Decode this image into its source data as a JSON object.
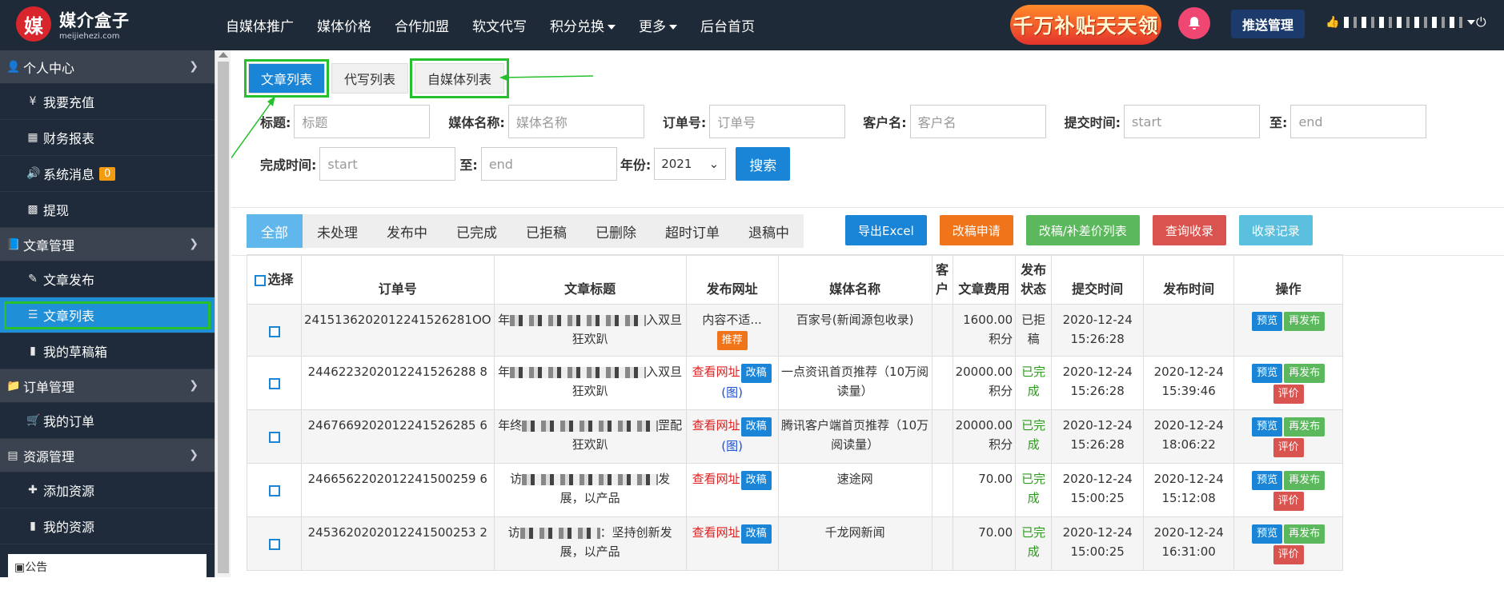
{
  "brand": {
    "logo_char": "媒",
    "name": "媒介盒子",
    "domain": "meijiehezi.com"
  },
  "topnav": [
    "自媒体推广",
    "媒体价格",
    "合作加盟",
    "软文代写",
    "积分兑换",
    "更多",
    "后台首页"
  ],
  "promo": "千万补贴天天领",
  "push_label": "推送管理",
  "sidebar": {
    "g1": "个人中心",
    "i1": "我要充值",
    "i2": "财务报表",
    "i3": "系统消息",
    "i3_badge": "0",
    "i4": "提现",
    "g2": "文章管理",
    "i5": "文章发布",
    "i6": "文章列表",
    "i7": "我的草稿箱",
    "g3": "订单管理",
    "i8": "我的订单",
    "g4": "资源管理",
    "i9": "添加资源",
    "i10": "我的资源",
    "notice": "公告"
  },
  "tabs": {
    "t1": "文章列表",
    "t2": "代写列表",
    "t3": "自媒体列表"
  },
  "filters": {
    "title_label": "标题:",
    "title_ph": "标题",
    "media_label": "媒体名称:",
    "media_ph": "媒体名称",
    "order_label": "订单号:",
    "order_ph": "订单号",
    "client_label": "客户名:",
    "client_ph": "客户名",
    "submit_label": "提交时间:",
    "start": "start",
    "to": "至:",
    "end": "end",
    "finish_label": "完成时间:",
    "year_label": "年份:",
    "year": "2021",
    "search": "搜索"
  },
  "status_tabs": [
    "全部",
    "未处理",
    "发布中",
    "已完成",
    "已拒稿",
    "已删除",
    "超时订单",
    "退稿中"
  ],
  "actions": [
    {
      "label": "导出Excel",
      "color": "#1a84d6"
    },
    {
      "label": "改稿申请",
      "color": "#f0741a"
    },
    {
      "label": "改稿/补差价列表",
      "color": "#5cb85c"
    },
    {
      "label": "查询收录",
      "color": "#d9534f"
    },
    {
      "label": "收录记录",
      "color": "#5bc0de"
    }
  ],
  "table": {
    "headers": {
      "select": "选择",
      "order": "订单号",
      "title": "文章标题",
      "url": "发布网址",
      "media": "媒体名称",
      "client": "客户",
      "fee": "文章费用",
      "status": "发布状态",
      "submit": "提交时间",
      "publish": "发布时间",
      "ops": "操作"
    },
    "rows": [
      {
        "order": "2415136202012241526281OO",
        "title_a": "年",
        "title_b": "入双旦",
        "title_c": "狂欢趴",
        "url_text": "内容不适...",
        "url_tag": "推荐",
        "media": "百家号(新闻源包收录)",
        "fee": "1600.00积分",
        "status": "已拒稿",
        "submit": "2020-12-24 15:26:28",
        "publish": "",
        "ops": [
          "预览",
          "再发布"
        ]
      },
      {
        "order": "2446223202012241526288 8",
        "title_a": "年",
        "title_b": "入双旦",
        "title_c": "狂欢趴",
        "url_text": "查看网址",
        "url_tag": "改稿",
        "url_extra": "(图)",
        "media": "一点资讯首页推荐（10万阅读量）",
        "fee": "20000.00积分",
        "status": "已完成",
        "submit": "2020-12-24 15:26:28",
        "publish": "2020-12-24 15:39:46",
        "ops": [
          "预览",
          "再发布",
          "评价"
        ]
      },
      {
        "order": "2467669202012241526285 6",
        "title_a": "年终",
        "title_b": "罡配",
        "title_c": "狂欢趴",
        "url_text": "查看网址",
        "url_tag": "改稿",
        "url_extra": "(图)",
        "media": "腾讯客户端首页推荐（10万阅读量）",
        "fee": "20000.00积分",
        "status": "已完成",
        "submit": "2020-12-24 15:26:28",
        "publish": "2020-12-24 18:06:22",
        "ops": [
          "预览",
          "再发布",
          "评价"
        ]
      },
      {
        "order": "2466562202012241500259 6",
        "title_a": "访",
        "title_b": "发",
        "title_c": "展，以产品",
        "url_text": "查看网址",
        "url_tag": "改稿",
        "media": "速途网",
        "fee": "70.00",
        "status": "已完成",
        "submit": "2020-12-24 15:00:25",
        "publish": "2020-12-24 15:12:08",
        "ops": [
          "预览",
          "再发布",
          "评价"
        ]
      },
      {
        "order": "2453620202012241500253 2",
        "title_a": "访",
        "title_b": "：坚持创新发",
        "title_c": "展，以产品",
        "url_text": "查看网址",
        "url_tag": "改稿",
        "media": "千龙网新闻",
        "fee": "70.00",
        "status": "已完成",
        "submit": "2020-12-24 15:00:25",
        "publish": "2020-12-24 16:31:00",
        "ops": [
          "预览",
          "再发布",
          "评价"
        ]
      }
    ]
  },
  "colors": {
    "accent": "#1a84d6",
    "highlight": "#25c02c",
    "sidebar": "#1f2b3a",
    "topbar": "#1e2a38"
  }
}
